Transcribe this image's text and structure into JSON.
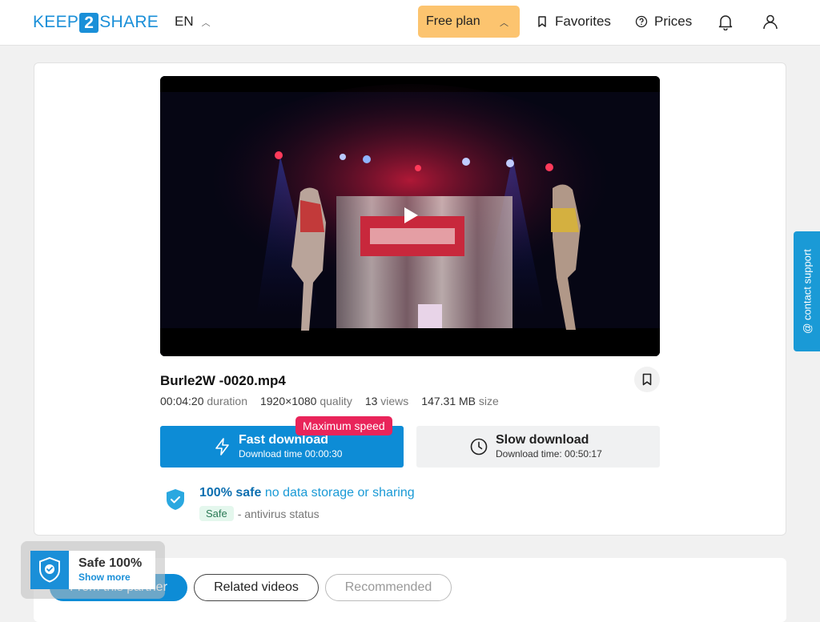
{
  "header": {
    "logo": {
      "part1": "KEEP",
      "part2": "2",
      "part3": "SHARE"
    },
    "language": "EN",
    "plan_label": "Free plan",
    "favorites_label": "Favorites",
    "prices_label": "Prices"
  },
  "file": {
    "name": "Burle2W -0020.mp4",
    "duration_value": "00:04:20",
    "duration_label": "duration",
    "quality_value": "1920×1080",
    "quality_label": "quality",
    "views_value": "13",
    "views_label": "views",
    "size_value": "147.31 MB",
    "size_label": "size"
  },
  "download": {
    "fast_label": "Fast download",
    "fast_time": "Download time 00:00:30",
    "badge": "Maximum speed",
    "slow_label": "Slow download",
    "slow_time": "Download time: 00:50:17"
  },
  "safety": {
    "strong": "100% safe",
    "light": "no data storage or sharing",
    "pill": "Safe",
    "status": "- antivirus status"
  },
  "support": {
    "label": "@ contact support"
  },
  "tabs": [
    {
      "label": "From this partner"
    },
    {
      "label": "Related videos"
    },
    {
      "label": "Recommended"
    }
  ],
  "safe_widget": {
    "title": "Safe 100%",
    "link": "Show more"
  },
  "colors": {
    "brand": "#1a8fd8",
    "plan": "#fcc46f",
    "badge": "#e9245a"
  }
}
